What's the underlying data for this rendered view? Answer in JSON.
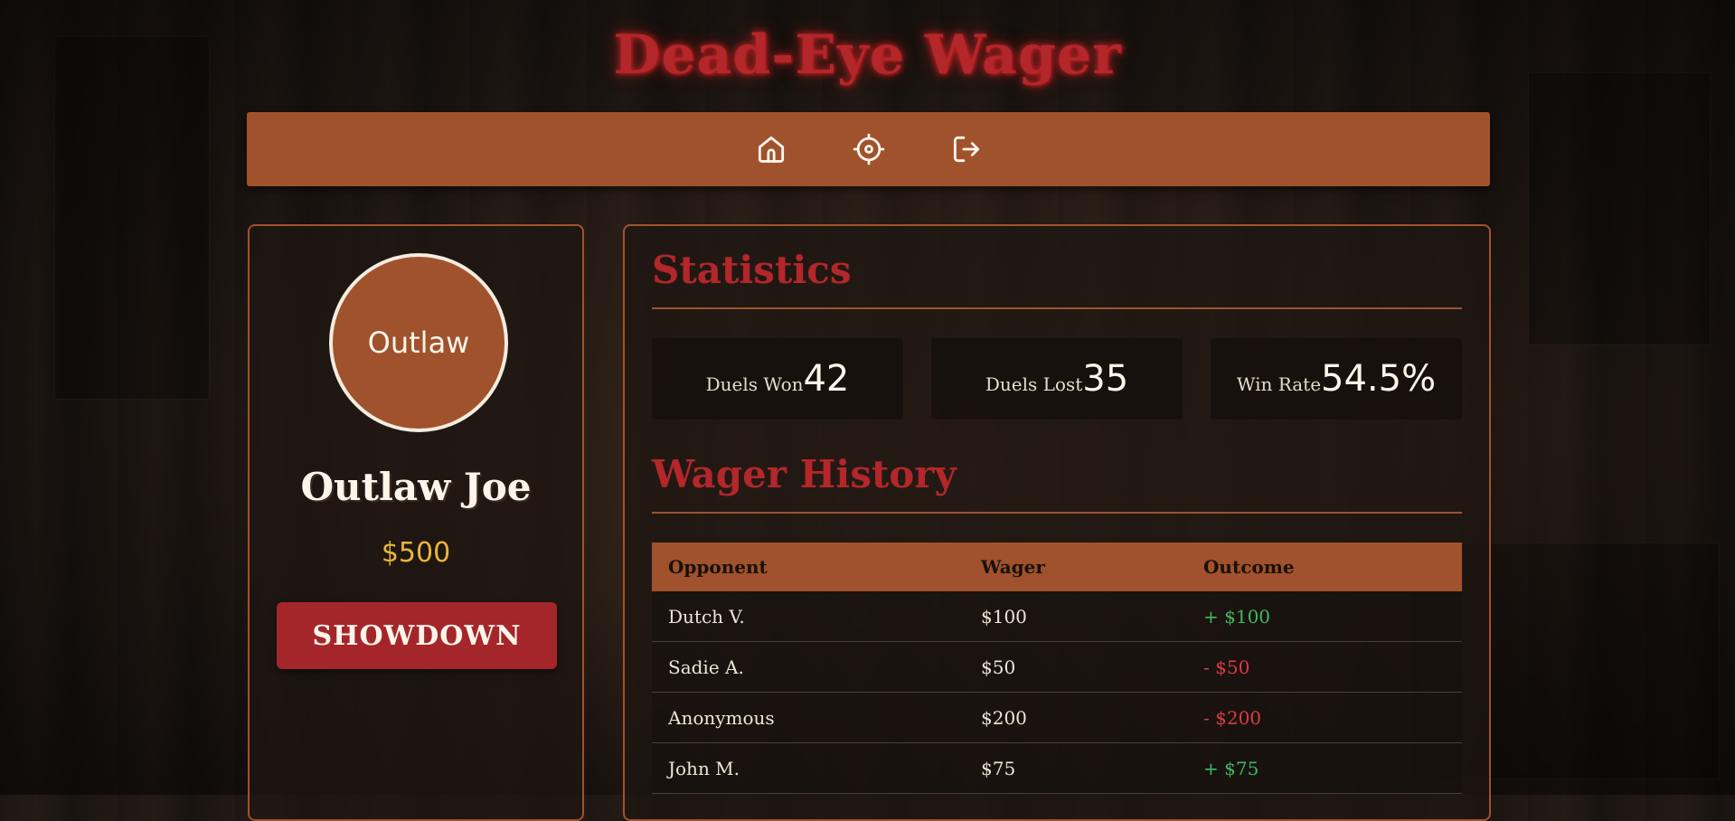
{
  "site_title": "Dead-Eye Wager",
  "nav": {
    "items": [
      {
        "icon": "home-icon"
      },
      {
        "icon": "crosshair-icon"
      },
      {
        "icon": "logout-icon"
      }
    ]
  },
  "profile": {
    "avatar_text": "Outlaw",
    "name": "Outlaw Joe",
    "money": "$500",
    "showdown_label": "SHOWDOWN"
  },
  "statistics": {
    "title": "Statistics",
    "duels_won_label": "Duels Won",
    "duels_won_value": "42",
    "duels_lost_label": "Duels Lost",
    "duels_lost_value": "35",
    "win_rate_label": "Win Rate",
    "win_rate_value": "54.5%"
  },
  "wager_history": {
    "title": "Wager History",
    "columns": [
      "Opponent",
      "Wager",
      "Outcome"
    ],
    "rows": [
      {
        "opponent": "Dutch V.",
        "wager": "$100",
        "outcome": "+ $100",
        "result": "win"
      },
      {
        "opponent": "Sadie A.",
        "wager": "$50",
        "outcome": "- $50",
        "result": "loss"
      },
      {
        "opponent": "Anonymous",
        "wager": "$200",
        "outcome": "- $200",
        "result": "loss"
      },
      {
        "opponent": "John M.",
        "wager": "$75",
        "outcome": "+ $75",
        "result": "win"
      }
    ]
  },
  "colors": {
    "accent": "#a0522d",
    "title_red": "#b3262a",
    "gold": "#e8b53a",
    "win": "#3fb860",
    "loss": "#dd3b46"
  }
}
